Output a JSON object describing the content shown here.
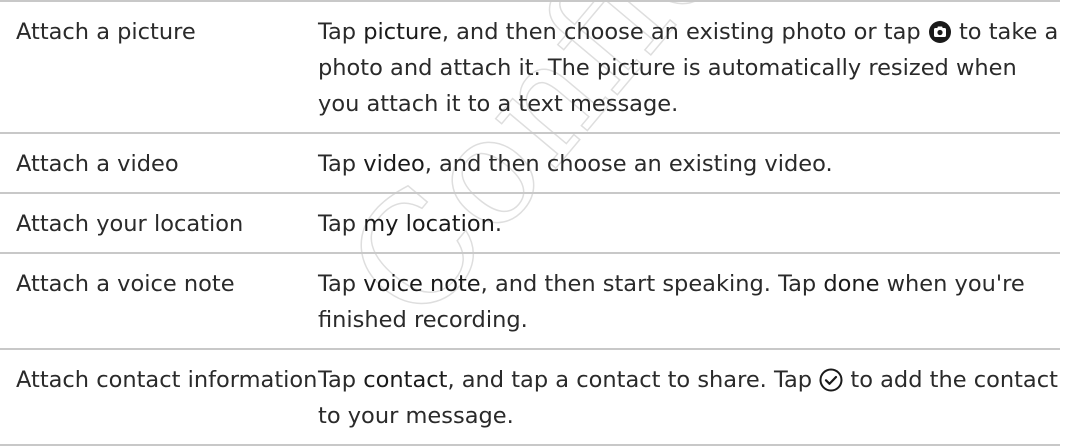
{
  "rows": [
    {
      "label": "Attach a picture",
      "desc": {
        "t1": "Tap ",
        "k1": "picture",
        "t2": ", and then choose an existing photo or tap ",
        "icon": "camera-icon",
        "t3": " to take a photo and attach it. The picture is automatically resized when you attach it to a text message."
      }
    },
    {
      "label": "Attach a video",
      "desc": {
        "t1": "Tap ",
        "k1": "video",
        "t2": ", and then choose an existing video."
      }
    },
    {
      "label": "Attach your location",
      "desc": {
        "t1": "Tap ",
        "k1": "my location",
        "t2": "."
      }
    },
    {
      "label": "Attach a voice note",
      "desc": {
        "t1": "Tap ",
        "k1": "voice note",
        "t2": ", and then start speaking. Tap ",
        "k2": "done",
        "t3": " when you're finished recording."
      }
    },
    {
      "label": "Attach contact information",
      "desc": {
        "t1": "Tap ",
        "k1": "contact",
        "t2": ", and tap a contact to share. Tap ",
        "icon": "check-circle-icon",
        "t3": " to add the contact to your message."
      }
    }
  ],
  "watermark": "Confidential"
}
